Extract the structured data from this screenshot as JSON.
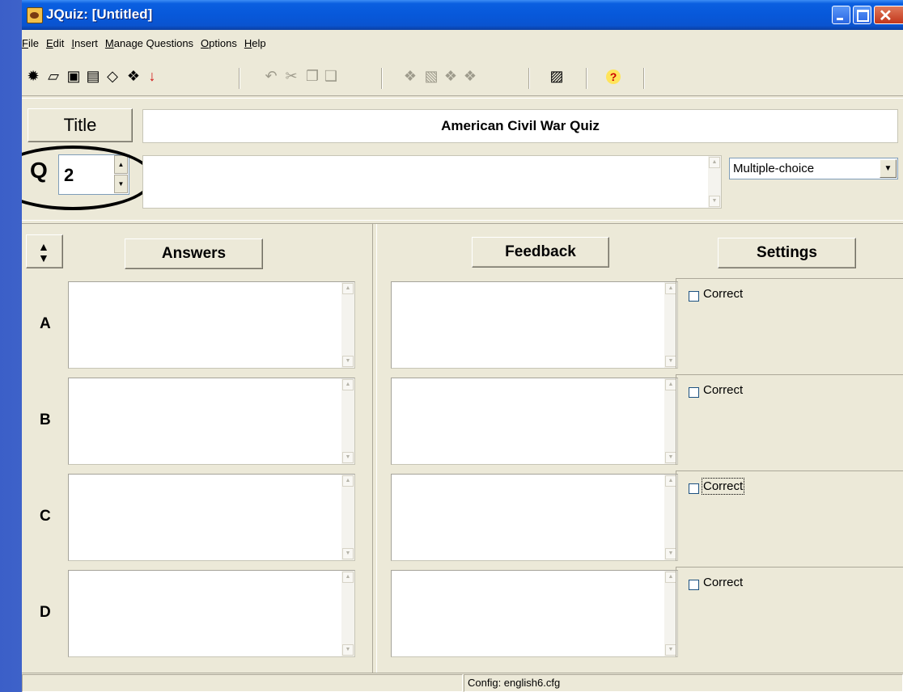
{
  "window": {
    "title": "JQuiz: [Untitled]"
  },
  "menu": [
    {
      "label": "File",
      "key": "F",
      "rest": "ile"
    },
    {
      "label": "Edit",
      "key": "E",
      "rest": "dit"
    },
    {
      "label": "Insert",
      "key": "I",
      "rest": "nsert"
    },
    {
      "label": "Manage Questions",
      "key": "M",
      "rest": "anage Questions"
    },
    {
      "label": "Options",
      "key": "O",
      "rest": "ptions"
    },
    {
      "label": "Help",
      "key": "H",
      "rest": "elp"
    }
  ],
  "toolbar": [
    {
      "icon": "new-file-icon",
      "glyph": "✹",
      "enabled": true
    },
    {
      "icon": "open-folder-icon",
      "glyph": "▱",
      "enabled": true
    },
    {
      "icon": "save-icon",
      "glyph": "▣",
      "enabled": true
    },
    {
      "icon": "save-as-icon",
      "glyph": "▤",
      "enabled": true
    },
    {
      "icon": "eraser-icon",
      "glyph": "◇",
      "enabled": true
    },
    {
      "icon": "create-web-page-icon",
      "glyph": "❖",
      "enabled": true
    },
    {
      "icon": "export-arrow-icon",
      "glyph": "↓",
      "enabled": true
    },
    {
      "icon": "undo-icon",
      "glyph": "↶",
      "enabled": false
    },
    {
      "icon": "cut-icon",
      "glyph": "✂",
      "enabled": false
    },
    {
      "icon": "copy-icon",
      "glyph": "❐",
      "enabled": false
    },
    {
      "icon": "paste-icon",
      "glyph": "❑",
      "enabled": false
    },
    {
      "icon": "add-question-icon",
      "glyph": "❖",
      "enabled": false
    },
    {
      "icon": "insert-picture-icon",
      "glyph": "▧",
      "enabled": false
    },
    {
      "icon": "delete-question-icon",
      "glyph": "❖",
      "enabled": false
    },
    {
      "icon": "move-question-icon",
      "glyph": "❖",
      "enabled": false
    },
    {
      "icon": "properties-icon",
      "glyph": "▨",
      "enabled": true
    },
    {
      "icon": "help-icon",
      "glyph": "?",
      "enabled": true
    }
  ],
  "title_section": {
    "label": "Title",
    "value": "American Civil War Quiz"
  },
  "question": {
    "label": "Q",
    "number": "2",
    "text": "",
    "type": "Multiple-choice"
  },
  "headers": {
    "answers": "Answers",
    "feedback": "Feedback",
    "settings": "Settings"
  },
  "answer_rows": [
    {
      "letter": "A",
      "answer": "",
      "feedback": "",
      "correct_label": "Correct",
      "checked": false
    },
    {
      "letter": "B",
      "answer": "",
      "feedback": "",
      "correct_label": "Correct",
      "checked": false
    },
    {
      "letter": "C",
      "answer": "",
      "feedback": "",
      "correct_label": "Correct",
      "checked": false
    },
    {
      "letter": "D",
      "answer": "",
      "feedback": "",
      "correct_label": "Correct",
      "checked": false
    }
  ],
  "status": {
    "left": "",
    "config": "Config: english6.cfg"
  }
}
